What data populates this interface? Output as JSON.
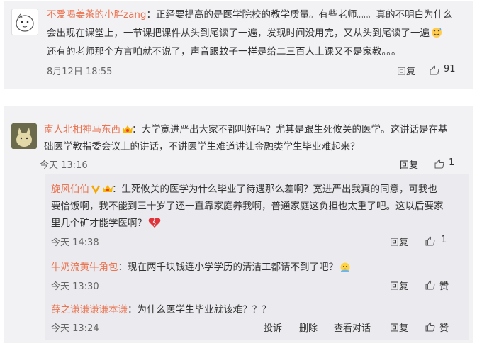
{
  "comment1": {
    "user": "不爱喝姜茶的小胖zang",
    "separator": "：",
    "line1": "正经要提高的是医学院校的教学质量。有些老师。。。真的不明白为什么",
    "line2": "会出现在课堂上，一节课把课件从头到尾读了一遍，发现时间没用完，又从头到尾读了一遍",
    "line3": "还有的老师那个方言咱就不说了，声音跟蚊子一样是给二三百人上课又不是家教。。。",
    "time": "8月12日 18:55",
    "reply": "回复",
    "likes": "91"
  },
  "comment2": {
    "user": "南人北相神马东西",
    "separator": "：",
    "line1": "大学宽进严出大家不都叫好吗？尤其是跟生死攸关的医学。这讲话是在基",
    "line2": "础医学教指委会议上的讲话，不讲医学生难道讲让金融类学生毕业难起来？",
    "time": "今天 13:16",
    "reply": "回复",
    "likes": "1"
  },
  "reply1": {
    "user": "旋风伯伯",
    "separator": "：",
    "line1": "生死攸关的医学为什么毕业了待遇那么差啊？宽进严出我真的同意，可我也",
    "line2": "要恰饭啊，我不能到三十岁了还一直靠家庭养我啊，普通家庭这负担也太重了吧。这以后要家",
    "line3": "里几个矿才能学医啊？",
    "time": "今天 14:38",
    "reply": "回复",
    "likes": "1"
  },
  "reply2": {
    "user": "牛奶流黄牛角包",
    "separator": "：",
    "line1": "现在两千块钱连小学学历的清洁工都请不到了吧？",
    "time": "今天 13:30",
    "reply": "回复",
    "likes": "赞"
  },
  "reply3": {
    "user": "薛之谦谦谦谦本谦",
    "separator": "：",
    "line1": "为什么医学生毕业就该难？？？",
    "time": "今天 13:24",
    "report": "投诉",
    "delete": "删除",
    "view_thread": "查看对话",
    "reply": "回复",
    "likes": "赞"
  },
  "colors": {
    "username": "#eb7350",
    "meta": "#666666",
    "text": "#333333"
  },
  "icons": [
    "avatar-cartoon",
    "avatar-cat",
    "verified-icon",
    "crown-badge-icon",
    "heart-broken-icon",
    "sweat-smile-emoji",
    "chick-emoji",
    "thumbs-up-icon"
  ]
}
